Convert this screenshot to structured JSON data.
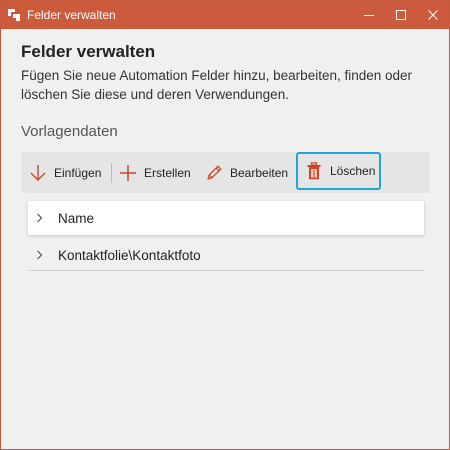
{
  "window": {
    "title": "Felder verwalten",
    "accent_color": "#cc5a3c",
    "controls": {
      "minimize": "minimize-icon",
      "maximize": "maximize-icon",
      "close": "close-icon"
    }
  },
  "header": {
    "title": "Felder verwalten",
    "description": "Fügen Sie neue Automation Felder hinzu, bearbeiten, finden oder löschen Sie diese und deren Verwendungen."
  },
  "section": {
    "title": "Vorlagendaten"
  },
  "toolbar": {
    "items": [
      {
        "label": "Einfügen",
        "icon": "arrow-down-icon"
      },
      {
        "label": "Erstellen",
        "icon": "plus-icon"
      },
      {
        "label": "Bearbeiten",
        "icon": "pencil-icon"
      },
      {
        "label": "Löschen",
        "icon": "trash-icon",
        "highlighted": true,
        "highlight_color": "#1ca6d9"
      }
    ]
  },
  "tree": {
    "items": [
      {
        "label": "Name",
        "icon": "chevron-right-icon"
      },
      {
        "label": "Kontaktfolie\\Kontaktfoto",
        "icon": "chevron-right-icon"
      }
    ]
  }
}
